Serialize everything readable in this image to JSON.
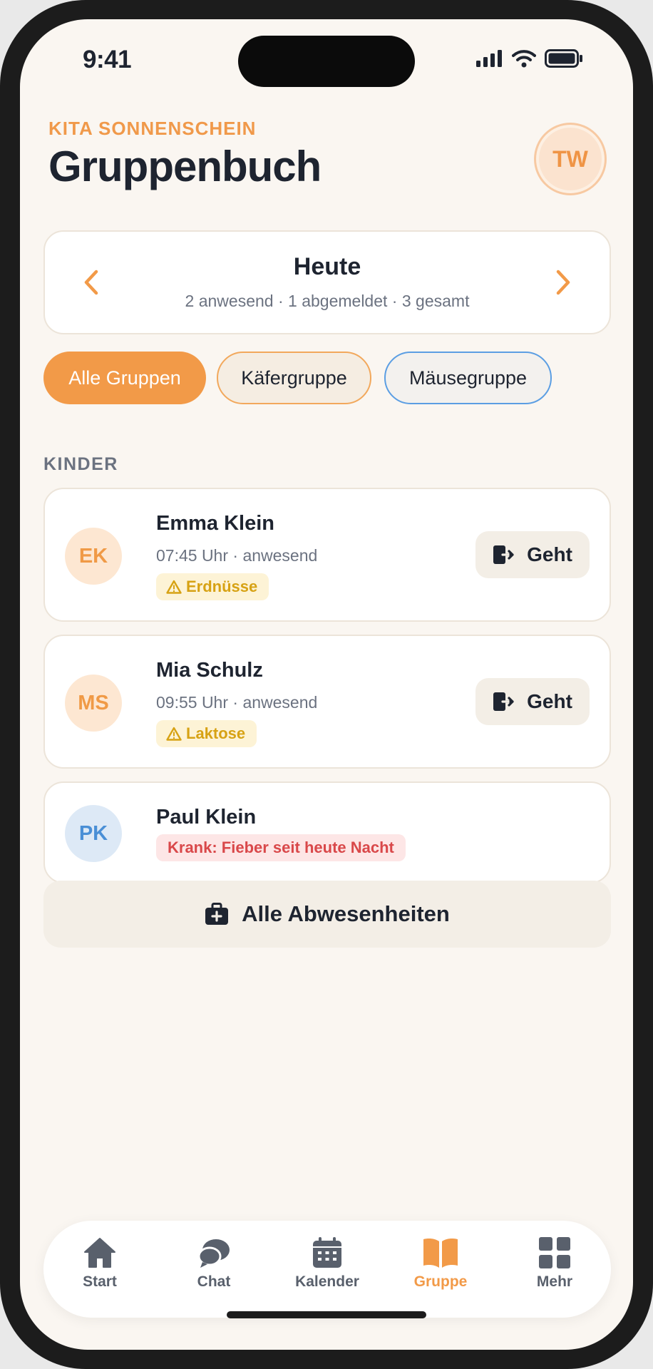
{
  "status_bar": {
    "time": "9:41"
  },
  "header": {
    "kicker": "KITA SONNENSCHEIN",
    "title": "Gruppenbuch",
    "avatar_initials": "TW"
  },
  "date_nav": {
    "title": "Heute",
    "summary": "2 anwesend · 1 abgemeldet · 3 gesamt"
  },
  "filters": [
    {
      "label": "Alle Gruppen",
      "active": true
    },
    {
      "label": "Käfergruppe",
      "active": false
    },
    {
      "label": "Mäusegruppe",
      "active": false
    }
  ],
  "section_label": "KINDER",
  "children": [
    {
      "initials": "EK",
      "name": "Emma Klein",
      "meta": "07:45 Uhr · anwesend",
      "tag": "Erdnüsse",
      "tag_icon": "warning-icon",
      "action": "Geht"
    },
    {
      "initials": "MS",
      "name": "Mia Schulz",
      "meta": "09:55 Uhr · anwesend",
      "tag": "Laktose",
      "tag_icon": "warning-icon",
      "action": "Geht"
    },
    {
      "initials": "PK",
      "name": "Paul Klein",
      "status": "Krank: Fieber seit heute Nacht"
    }
  ],
  "absences_button": {
    "label": "Alle Abwesenheiten",
    "icon": "medical-bag-icon"
  },
  "tabbar": [
    {
      "label": "Start",
      "icon": "home-icon",
      "active": false
    },
    {
      "label": "Chat",
      "icon": "chat-icon",
      "active": false
    },
    {
      "label": "Kalender",
      "icon": "calendar-icon",
      "active": false
    },
    {
      "label": "Gruppe",
      "icon": "book-icon",
      "active": true
    },
    {
      "label": "Mehr",
      "icon": "grid-icon",
      "active": false
    }
  ],
  "colors": {
    "accent": "#f29a48",
    "background": "#faf6f1",
    "text": "#1e2430",
    "muted": "#6b7280",
    "allergy": "#d7a214",
    "sick": "#d9484a",
    "blue": "#4a8fd6"
  }
}
